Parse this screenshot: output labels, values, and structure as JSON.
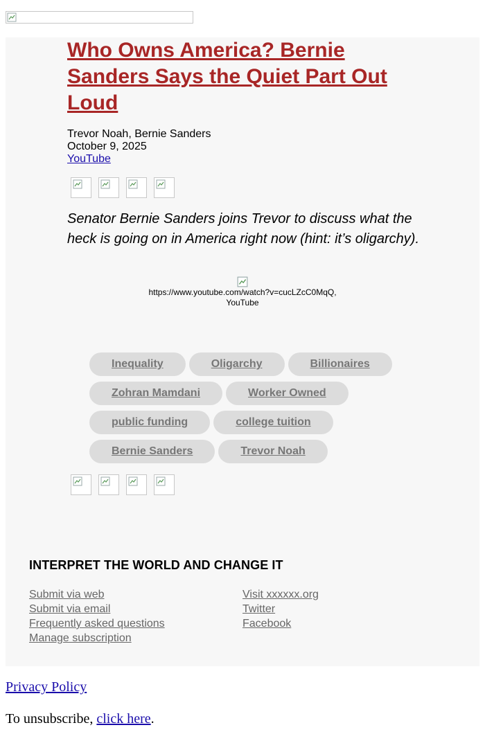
{
  "header": {
    "logo_icon": "broken-image-icon"
  },
  "article": {
    "title": "Who Owns America? Bernie Sanders Says the Quiet Part Out Loud",
    "authors": "Trevor Noah, Bernie Sanders",
    "date": "October 9, 2025",
    "source": "YouTube",
    "summary": "Senator Bernie Sanders joins Trevor to discuss what the heck is going on in America right now (hint: it’s oligarchy).",
    "video_caption_url": "https://www.youtube.com/watch?v=cucLZcC0MqQ,",
    "video_caption_source": "YouTube"
  },
  "share_icons": [
    "share-icon-1",
    "share-icon-2",
    "share-icon-3",
    "share-icon-4"
  ],
  "tags": [
    [
      "Inequality",
      "Oligarchy",
      "Billionaires"
    ],
    [
      "Zohran Mamdani",
      "Worker Owned"
    ],
    [
      "public funding",
      "college tuition"
    ],
    [
      "Bernie Sanders",
      "Trevor Noah"
    ]
  ],
  "footer": {
    "heading": "INTERPRET THE WORLD AND CHANGE IT",
    "left_links": [
      "Submit via web",
      "Submit via email",
      "Frequently asked questions",
      "Manage subscription"
    ],
    "right_links": [
      "Visit xxxxxx.org",
      "Twitter",
      "Facebook"
    ]
  },
  "bottom": {
    "privacy": "Privacy Policy",
    "unsubscribe_prefix": "To unsubscribe, ",
    "unsubscribe_link": "click here",
    "unsubscribe_suffix": "."
  }
}
